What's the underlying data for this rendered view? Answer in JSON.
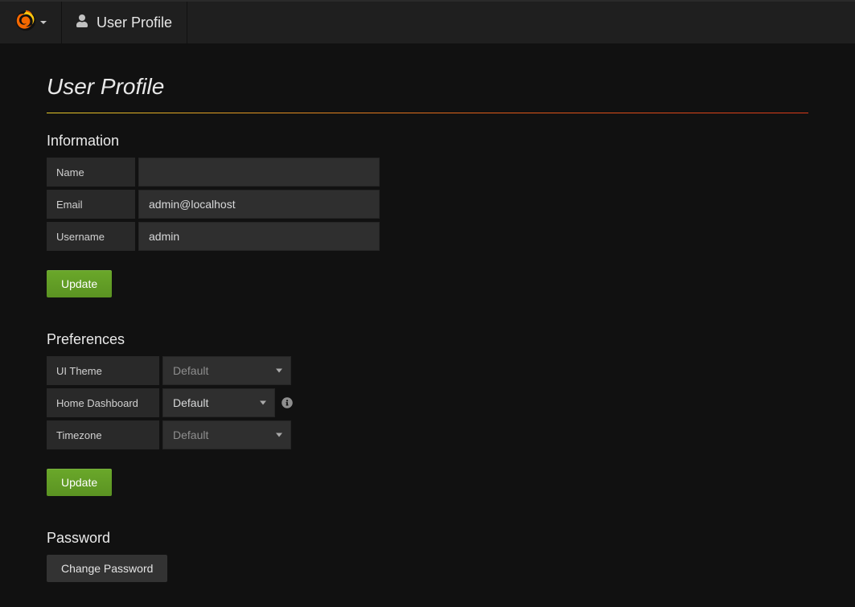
{
  "navbar": {
    "title": "User Profile"
  },
  "page": {
    "title": "User Profile"
  },
  "information": {
    "heading": "Information",
    "name": {
      "label": "Name",
      "value": ""
    },
    "email": {
      "label": "Email",
      "value": "admin@localhost"
    },
    "username": {
      "label": "Username",
      "value": "admin"
    },
    "update_label": "Update"
  },
  "preferences": {
    "heading": "Preferences",
    "ui_theme": {
      "label": "UI Theme",
      "value": "Default"
    },
    "home_dashboard": {
      "label": "Home Dashboard",
      "value": "Default"
    },
    "timezone": {
      "label": "Timezone",
      "value": "Default"
    },
    "update_label": "Update"
  },
  "password": {
    "heading": "Password",
    "change_label": "Change Password"
  }
}
